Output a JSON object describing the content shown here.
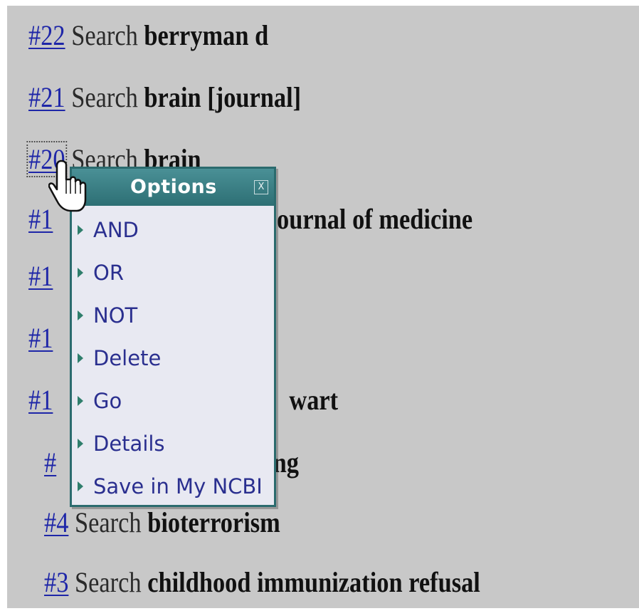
{
  "history": [
    {
      "num": "#22",
      "word": "Search",
      "term": "berryman d"
    },
    {
      "num": "#21",
      "word": "Search",
      "term": "brain [journal]"
    },
    {
      "num": "#20",
      "word": "Search",
      "term": "brain"
    },
    {
      "num": "#1",
      "word": "",
      "term": "and journal of medicine"
    },
    {
      "num": "#1",
      "word": "",
      "term": ""
    },
    {
      "num": "#1",
      "word": "",
      "term": ""
    },
    {
      "num": "#1",
      "word": "",
      "term": "wart"
    },
    {
      "num": "#",
      "word": "",
      "term": "ng"
    },
    {
      "num": "#4",
      "word": "Search",
      "term": "bioterrorism"
    },
    {
      "num": "#3",
      "word": "Search",
      "term": "childhood immunization refusal"
    }
  ],
  "popup": {
    "title": "Options",
    "close_label": "X",
    "items": [
      {
        "label": "AND"
      },
      {
        "label": "OR"
      },
      {
        "label": "NOT"
      },
      {
        "label": "Delete"
      },
      {
        "label": "Go"
      },
      {
        "label": "Details"
      },
      {
        "label": "Save in My NCBI"
      }
    ]
  },
  "icons": {
    "cursor": "hand-pointer-icon",
    "menu_bullet": "triangle-right-icon",
    "close": "close-icon"
  },
  "colors": {
    "background": "#c8c8c8",
    "link": "#1e26a8",
    "popup_header": "#3b8288",
    "popup_body": "#e8e9f2",
    "menu_text": "#2a2f8f"
  }
}
